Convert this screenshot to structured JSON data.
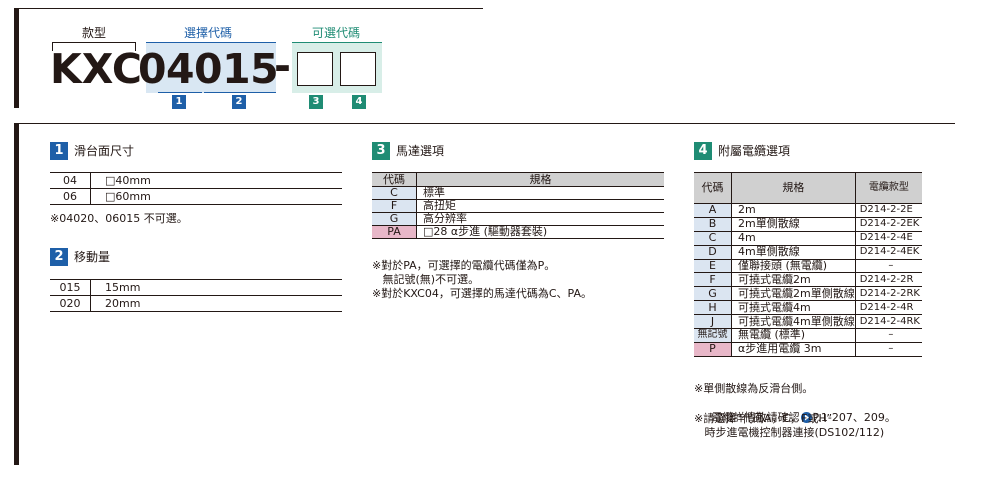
{
  "header": {
    "label_model": "款型",
    "label_select_code": "選擇代碼",
    "label_optional_code": "可選代碼",
    "model_prefix": "KXC",
    "model_code": "04015",
    "dash": "-",
    "badges": [
      "1",
      "2",
      "3",
      "4"
    ]
  },
  "sec1": {
    "num": "1",
    "title": "滑台面尺寸",
    "rows": [
      {
        "code": "04",
        "spec": "□40mm"
      },
      {
        "code": "06",
        "spec": "□60mm"
      }
    ],
    "note": "※04020、06015 不可選。"
  },
  "sec2": {
    "num": "2",
    "title": "移動量",
    "rows": [
      {
        "code": "015",
        "spec": "15mm"
      },
      {
        "code": "020",
        "spec": "20mm"
      }
    ]
  },
  "sec3": {
    "num": "3",
    "title": "馬達選項",
    "col_code": "代碼",
    "col_spec": "規格",
    "rows": [
      {
        "code": "C",
        "spec": "標準"
      },
      {
        "code": "F",
        "spec": "高扭矩"
      },
      {
        "code": "G",
        "spec": "高分辨率"
      },
      {
        "code": "PA",
        "spec": "□28 α步進 (驅動器套裝)"
      }
    ],
    "notes": [
      "※對於PA，可選擇的電纜代碼僅為P。",
      "   無記號(無)不可選。",
      "※對於KXC04，可選擇的馬達代碼為C、PA。"
    ]
  },
  "sec4": {
    "num": "4",
    "title": "附屬電纜選項",
    "col_code": "代碼",
    "col_spec": "規格",
    "col_cable": "電纜款型",
    "rows": [
      {
        "code": "A",
        "spec": "2m",
        "cable": "D214-2-2E"
      },
      {
        "code": "B",
        "spec": "2m單側散線",
        "cable": "D214-2-2EK"
      },
      {
        "code": "C",
        "spec": "4m",
        "cable": "D214-2-4E"
      },
      {
        "code": "D",
        "spec": "4m單側散線",
        "cable": "D214-2-4EK"
      },
      {
        "code": "E",
        "spec": "僅聯接頭 (無電纜)",
        "cable": "–"
      },
      {
        "code": "F",
        "spec": "可撓式電纜2m",
        "cable": "D214-2-2R"
      },
      {
        "code": "G",
        "spec": "可撓式電纜2m單側散線",
        "cable": "D214-2-2RK"
      },
      {
        "code": "H",
        "spec": "可撓式電纜4m",
        "cable": "D214-2-4R"
      },
      {
        "code": "J",
        "spec": "可撓式電纜4m單側散線",
        "cable": "D214-2-4RK"
      },
      {
        "code": "無記號",
        "spec": "無電纜 (標準)",
        "cable": "–"
      },
      {
        "code": "P",
        "spec": "α步進用電纜 3m",
        "cable": "–"
      }
    ],
    "note1": "※單側散線為反滑台側。",
    "note2_pre": "   電纜詳情敬請確認",
    "note2_ref": "P.1-207、209。",
    "note3": "※請選擇“代碼A，C，F或H”",
    "note4": "   時步進電機控制器連接(DS102/112)"
  },
  "colors": {
    "blue": "#1e5fa8",
    "green": "#1f8c74",
    "pink": "#e8b7c8",
    "header_gray": "#d0d0d0",
    "code_bg": "#dbe5f1"
  }
}
